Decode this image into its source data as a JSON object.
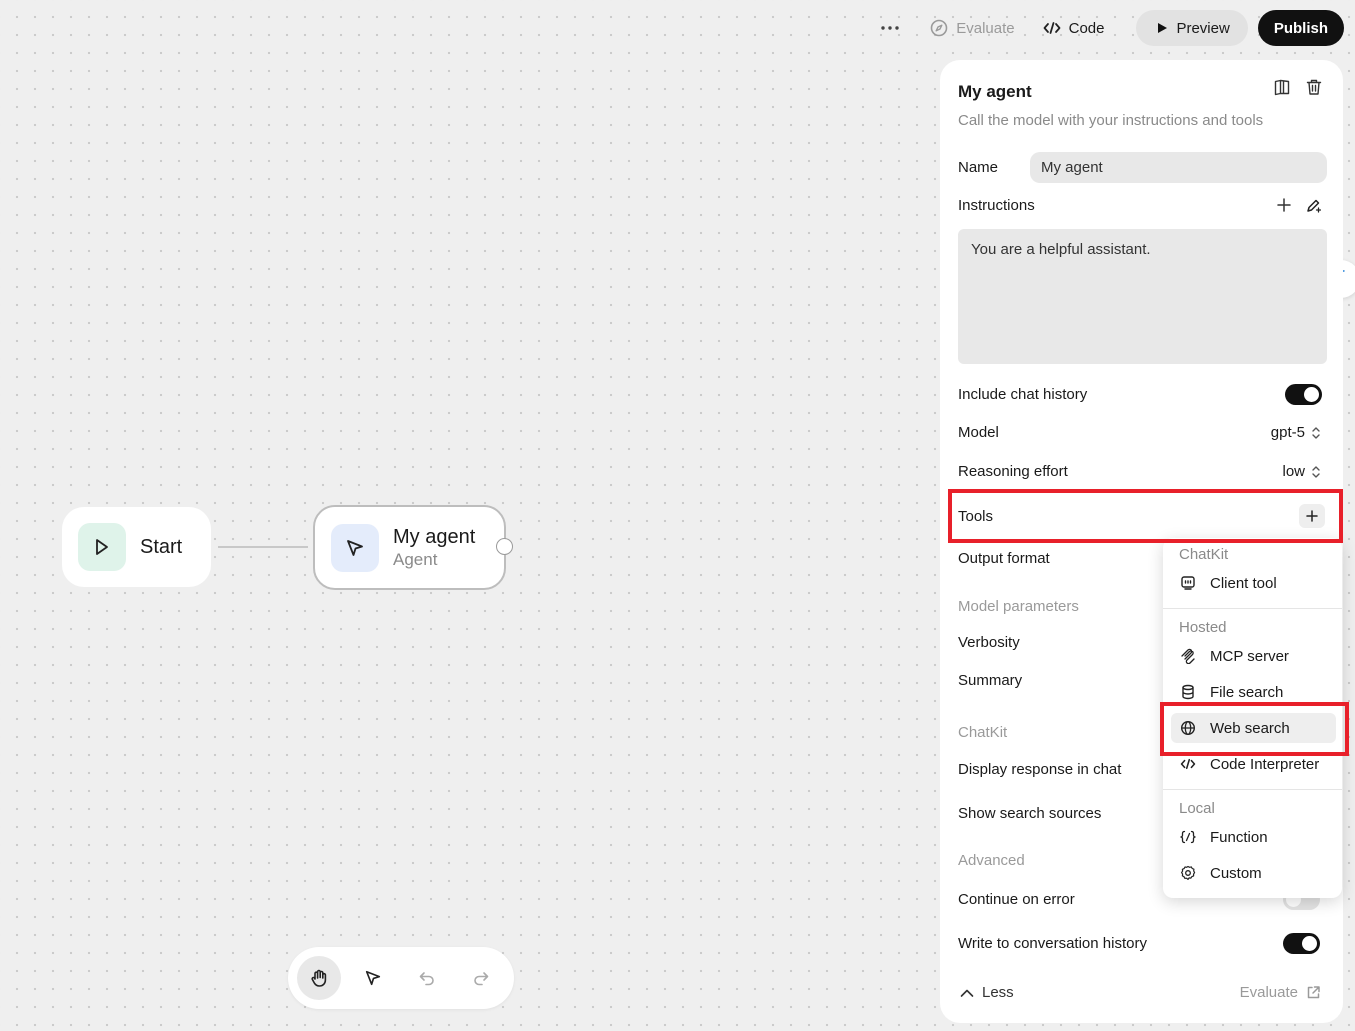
{
  "toolbar": {
    "evaluate_label": "Evaluate",
    "code_label": "Code",
    "preview_label": "Preview",
    "publish_label": "Publish"
  },
  "canvas": {
    "start_node": {
      "title": "Start",
      "icon": "play-icon"
    },
    "agent_node": {
      "title": "My agent",
      "subtitle": "Agent",
      "icon": "cursor-icon"
    },
    "tools": [
      "hand-icon",
      "pointer-icon",
      "undo-icon",
      "redo-icon"
    ]
  },
  "panel": {
    "title": "My agent",
    "subtitle": "Call the model with your instructions and tools",
    "name_label": "Name",
    "name_value": "My agent",
    "instructions_label": "Instructions",
    "instructions_value": "You are a helpful assistant.",
    "include_history_label": "Include chat history",
    "include_history_on": true,
    "model_label": "Model",
    "model_value": "gpt-5",
    "reasoning_label": "Reasoning effort",
    "reasoning_value": "low",
    "tools_label": "Tools",
    "output_format_label": "Output format",
    "model_params_header": "Model parameters",
    "verbosity_label": "Verbosity",
    "summary_label": "Summary",
    "chatkit_header": "ChatKit",
    "display_response_label": "Display response in chat",
    "show_sources_label": "Show search sources",
    "advanced_header": "Advanced",
    "continue_error_label": "Continue on error",
    "continue_error_on": false,
    "write_history_label": "Write to conversation history",
    "write_history_on": true,
    "less_label": "Less",
    "evaluate_link": "Evaluate"
  },
  "tools_menu": {
    "sections": [
      {
        "header": "ChatKit",
        "items": [
          {
            "label": "Client tool",
            "icon": "client-tool-icon"
          }
        ]
      },
      {
        "header": "Hosted",
        "items": [
          {
            "label": "MCP server",
            "icon": "mcp-icon"
          },
          {
            "label": "File search",
            "icon": "database-icon"
          },
          {
            "label": "Web search",
            "icon": "globe-icon",
            "highlighted": true
          },
          {
            "label": "Code Interpreter",
            "icon": "code-icon"
          }
        ]
      },
      {
        "header": "Local",
        "items": [
          {
            "label": "Function",
            "icon": "function-icon"
          },
          {
            "label": "Custom",
            "icon": "gear-icon"
          }
        ]
      }
    ]
  },
  "colors": {
    "highlight": "#e8202a",
    "publish_bg": "#111111",
    "node_start_icon_bg": "#dff3ea",
    "node_agent_icon_bg": "#e4ecfb"
  }
}
